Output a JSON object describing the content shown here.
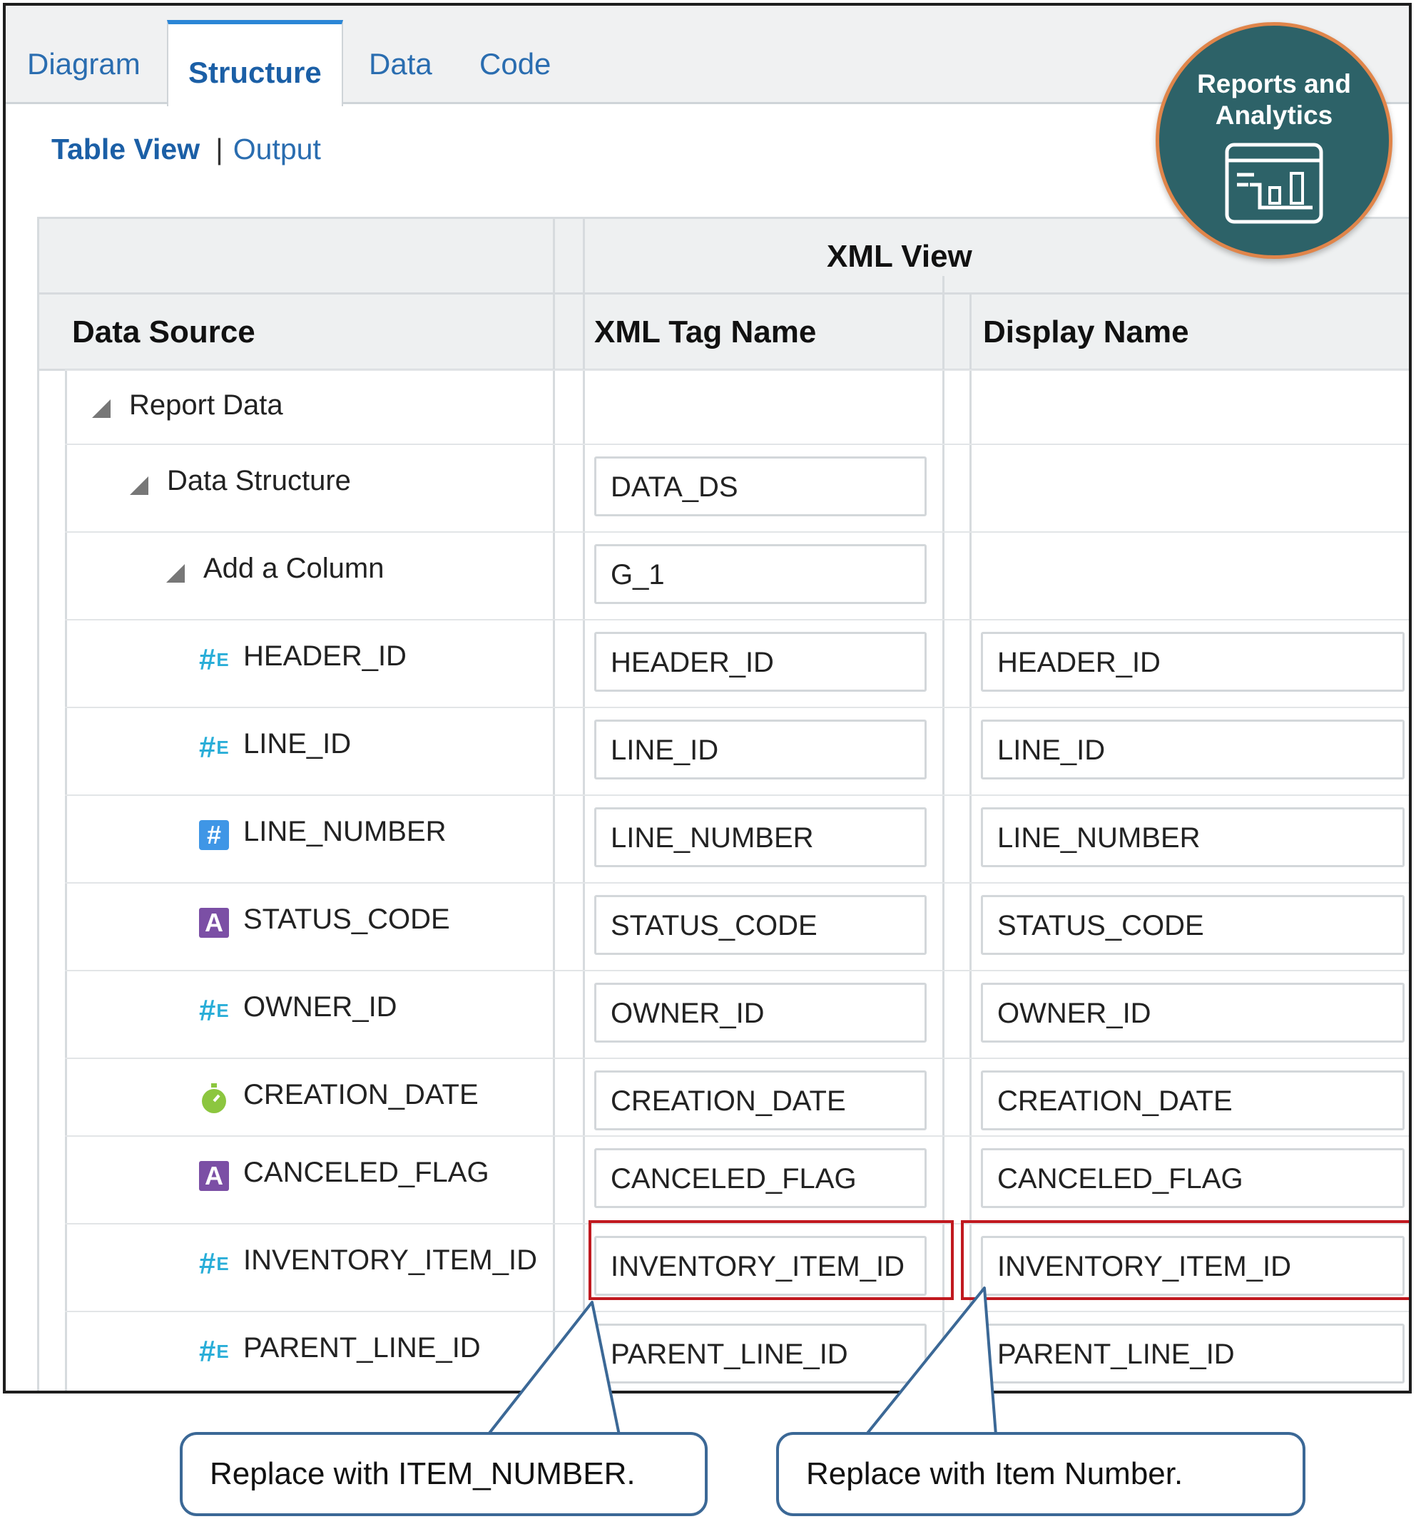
{
  "tabs": [
    {
      "label": "Diagram",
      "active": false
    },
    {
      "label": "Structure",
      "active": true
    },
    {
      "label": "Data",
      "active": false
    },
    {
      "label": "Code",
      "active": false
    }
  ],
  "subnav": {
    "table_view": "Table View",
    "separator": "|",
    "output": "Output"
  },
  "badge": {
    "line1": "Reports and",
    "line2": "Analytics",
    "icon": "report-chart-icon"
  },
  "table": {
    "group_header": "XML View",
    "col_data_source": "Data Source",
    "col_xml_tag": "XML Tag Name",
    "col_display": "Display Name",
    "rows": [
      {
        "label": "Report Data",
        "icon": "collapse-triangle-icon",
        "xml": "",
        "display": ""
      },
      {
        "label": "Data Structure",
        "icon": "collapse-triangle-icon",
        "xml": "DATA_DS",
        "display": ""
      },
      {
        "label": "Add a Column",
        "icon": "collapse-triangle-icon",
        "xml": "G_1",
        "display": ""
      },
      {
        "label": "HEADER_ID",
        "icon": "number-element-icon",
        "xml": "HEADER_ID",
        "display": "HEADER_ID"
      },
      {
        "label": "LINE_ID",
        "icon": "number-element-icon",
        "xml": "LINE_ID",
        "display": "LINE_ID"
      },
      {
        "label": "LINE_NUMBER",
        "icon": "number-box-icon",
        "xml": "LINE_NUMBER",
        "display": "LINE_NUMBER"
      },
      {
        "label": "STATUS_CODE",
        "icon": "alpha-icon",
        "xml": "STATUS_CODE",
        "display": "STATUS_CODE"
      },
      {
        "label": "OWNER_ID",
        "icon": "number-element-icon",
        "xml": "OWNER_ID",
        "display": "OWNER_ID"
      },
      {
        "label": "CREATION_DATE",
        "icon": "date-stopwatch-icon",
        "xml": "CREATION_DATE",
        "display": "CREATION_DATE"
      },
      {
        "label": "CANCELED_FLAG",
        "icon": "alpha-icon",
        "xml": "CANCELED_FLAG",
        "display": "CANCELED_FLAG"
      },
      {
        "label": "INVENTORY_ITEM_ID",
        "icon": "number-element-icon",
        "xml": "INVENTORY_ITEM_ID",
        "display": "INVENTORY_ITEM_ID"
      },
      {
        "label": "PARENT_LINE_ID",
        "icon": "number-element-icon",
        "xml": "PARENT_LINE_ID",
        "display": "PARENT_LINE_ID"
      }
    ]
  },
  "callouts": {
    "xml": "Replace with ITEM_NUMBER.",
    "display": "Replace with Item Number."
  },
  "colors": {
    "highlight": "#c0191f",
    "callout_border": "#3b6896",
    "badge_bg": "#2d6268",
    "badge_ring": "#e0854a",
    "accent": "#2b86d6"
  }
}
